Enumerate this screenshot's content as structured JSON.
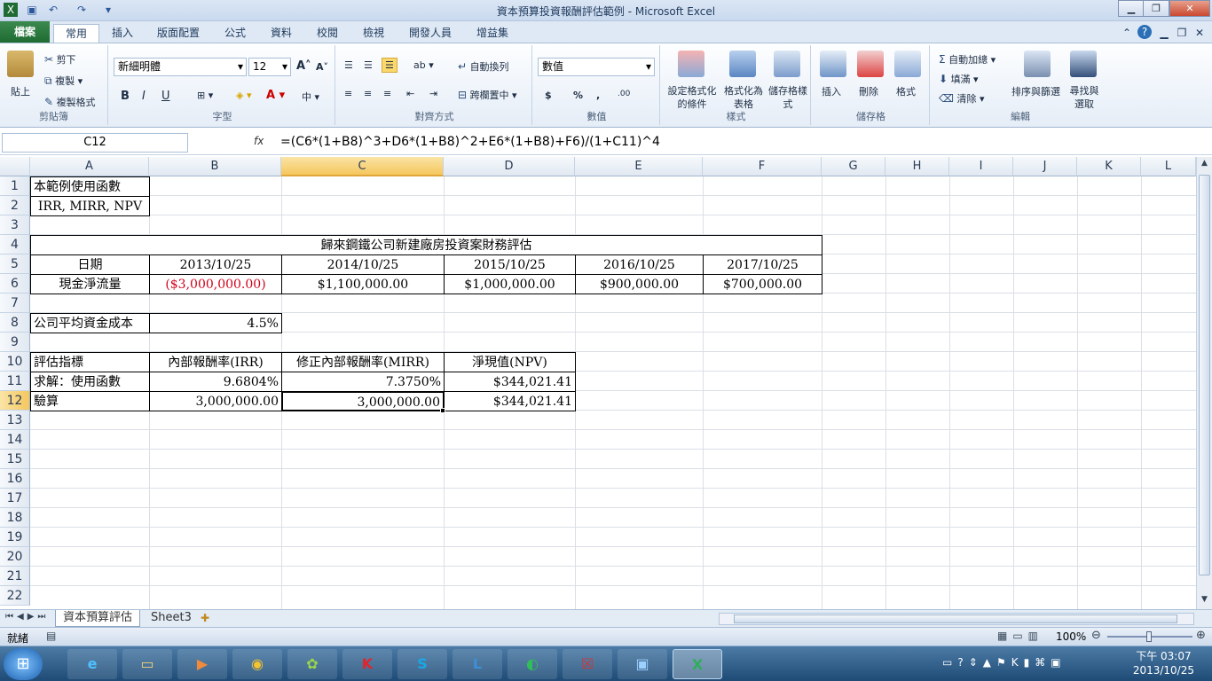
{
  "window": {
    "title": "資本預算投資報酬評估範例 - Microsoft Excel"
  },
  "ribbon_tabs": [
    "檔案",
    "常用",
    "插入",
    "版面配置",
    "公式",
    "資料",
    "校閱",
    "檢視",
    "開發人員",
    "增益集"
  ],
  "ribbon": {
    "clipboard": {
      "paste": "貼上",
      "cut": "剪下",
      "copy": "複製",
      "format_painter": "複製格式",
      "label": "剪貼簿"
    },
    "font": {
      "name": "新細明體",
      "size": "12",
      "label": "字型",
      "bold": "B",
      "italic": "I",
      "underline": "U"
    },
    "alignment": {
      "wrap": "自動換列",
      "merge": "跨欄置中",
      "label": "對齊方式"
    },
    "number": {
      "format": "數值",
      "currency": "$",
      "percent": "%",
      "comma": ",",
      "inc": ".00",
      "label": "數值"
    },
    "styles": {
      "cond": "設定格式化的條件",
      "table": "格式化為表格",
      "cell": "儲存格樣式",
      "label": "樣式"
    },
    "cells": {
      "insert": "插入",
      "delete": "刪除",
      "format": "格式",
      "label": "儲存格"
    },
    "editing": {
      "autosum": "自動加總",
      "fill": "填滿",
      "clear": "清除",
      "sort": "排序與篩選",
      "find": "尋找與選取",
      "label": "編輯"
    }
  },
  "formula_bar": {
    "name_box": "C12",
    "fx": "fx",
    "formula": "=(C6*(1+B8)^3+D6*(1+B8)^2+E6*(1+B8)+F6)/(1+C11)^4"
  },
  "columns": [
    "A",
    "B",
    "C",
    "D",
    "E",
    "F",
    "G",
    "H",
    "I",
    "J",
    "K",
    "L"
  ],
  "rows": [
    "1",
    "2",
    "3",
    "4",
    "5",
    "6",
    "7",
    "8",
    "9",
    "10",
    "11",
    "12",
    "13",
    "14",
    "15",
    "16",
    "17",
    "18",
    "19",
    "20",
    "21",
    "22"
  ],
  "cells": {
    "A1": "本範例使用函數",
    "A2": "IRR, MIRR, NPV",
    "A4": "歸來鋼鐵公司新建廠房投資案財務評估",
    "A5": "日期",
    "B5": "2013/10/25",
    "C5": "2014/10/25",
    "D5": "2015/10/25",
    "E5": "2016/10/25",
    "F5": "2017/10/25",
    "A6": "現金淨流量",
    "B6": "($3,000,000.00)",
    "C6": "$1,100,000.00",
    "D6": "$1,000,000.00",
    "E6": "$900,000.00",
    "F6": "$700,000.00",
    "A8": "公司平均資金成本",
    "B8": "4.5%",
    "A10": "評估指標",
    "B10": "內部報酬率(IRR)",
    "C10": "修正內部報酬率(MIRR)",
    "D10": "淨現值(NPV)",
    "A11": "求解：使用函數",
    "B11": "9.6804%",
    "C11": "7.3750%",
    "D11": "$344,021.41",
    "A12": "驗算",
    "B12": "3,000,000.00",
    "C12": "3,000,000.00",
    "D12": "$344,021.41"
  },
  "sheets": [
    "資本預算評估",
    "Sheet3"
  ],
  "status": {
    "ready": "就緒",
    "zoom": "100%"
  },
  "taskbar": {
    "time": "下午 03:07",
    "date": "2013/10/25"
  },
  "colors": {
    "negative": "#d0021b",
    "accent": "#1f6b33"
  }
}
